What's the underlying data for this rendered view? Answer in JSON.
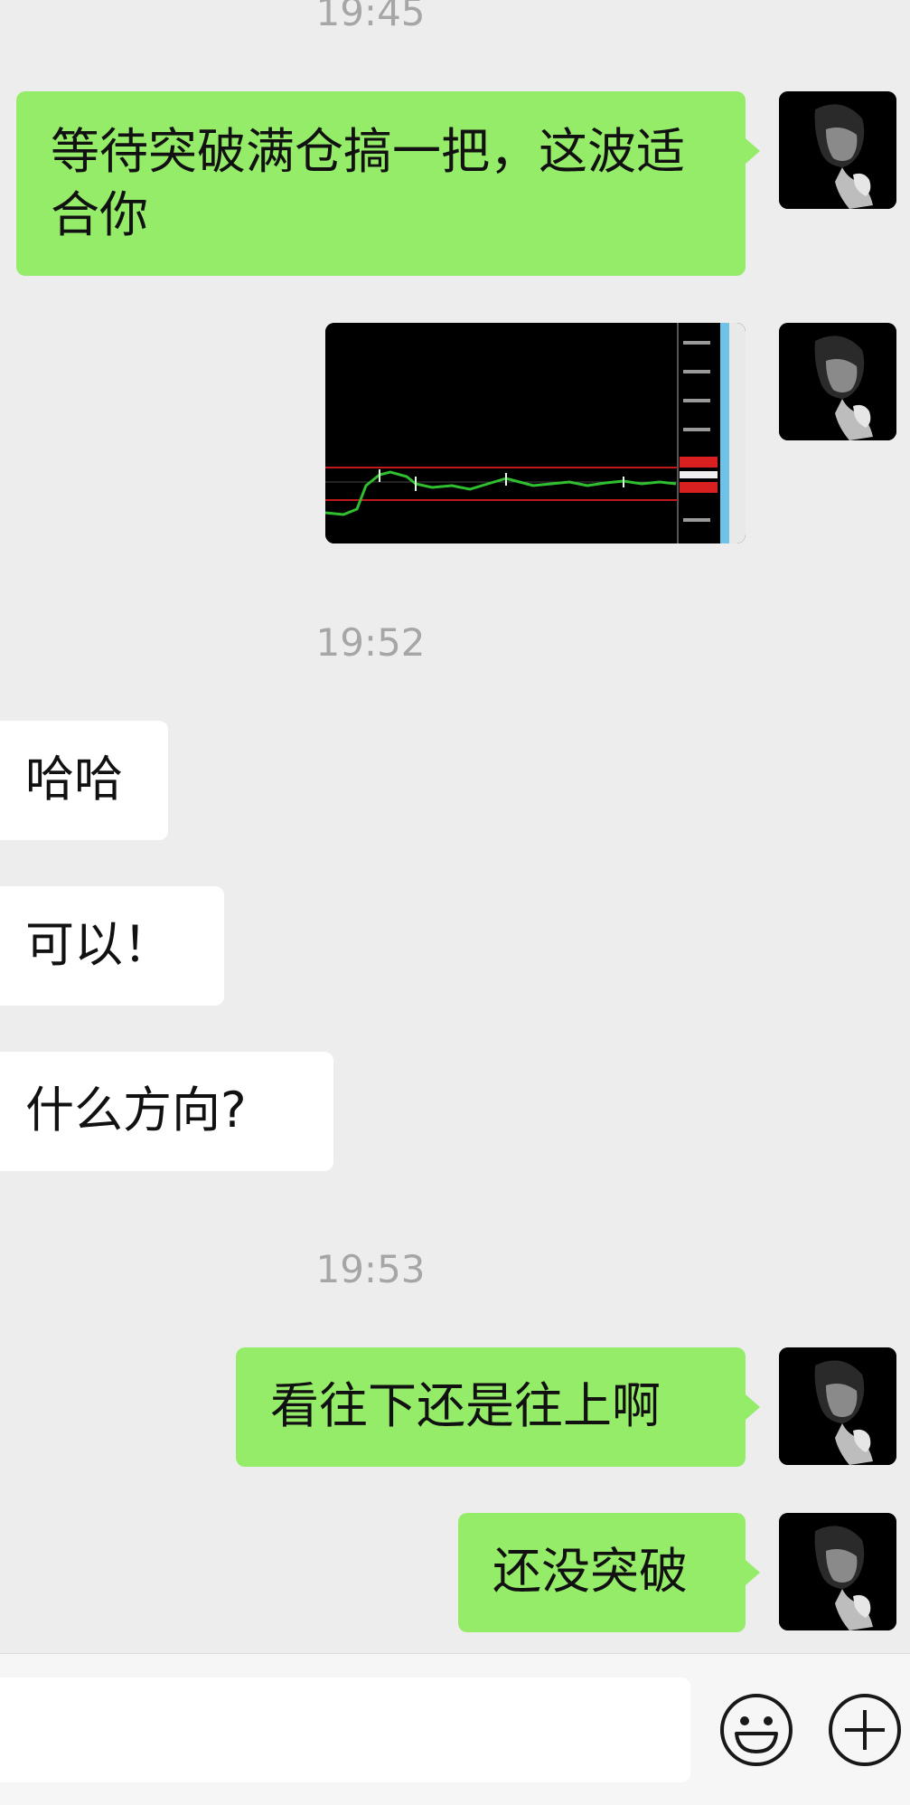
{
  "timestamps": [
    "19:45",
    "19:52",
    "19:53"
  ],
  "messages": {
    "m1": "等待突破满仓搞一把，这波适合你",
    "m2": "哈哈",
    "m3": "可以！",
    "m4": "什么方向?",
    "m5": "看往下还是往上啊",
    "m6": "还没突破"
  },
  "input": {
    "value": ""
  },
  "icons": {
    "emoji": "smiley-icon",
    "more": "plus-circle-icon"
  },
  "colors": {
    "sent_bubble": "#95ec69",
    "received_bubble": "#ffffff",
    "background": "#ededed"
  }
}
